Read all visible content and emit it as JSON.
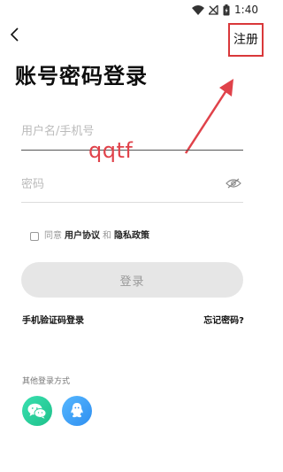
{
  "status_bar": {
    "time": "1:40"
  },
  "header": {
    "register_label": "注册"
  },
  "title": "账号密码登录",
  "annotation": {
    "handwritten_text": "qqtf"
  },
  "form": {
    "username_placeholder": "用户名/手机号",
    "password_placeholder": "密码"
  },
  "agreement": {
    "prefix": "同意",
    "user_agreement": "用户协议",
    "and": "和",
    "privacy_policy": "隐私政策"
  },
  "login_label": "登录",
  "links": {
    "sms_login": "手机验证码登录",
    "forgot_password": "忘记密码?"
  },
  "other_login": {
    "label": "其他登录方式",
    "providers": [
      "wechat-icon",
      "qq-icon"
    ]
  },
  "colors": {
    "annotation": "#e0424a",
    "wechat": "#2cd09c",
    "qq": "#3fa2f8",
    "login_disabled_bg": "#e6e6e6"
  }
}
